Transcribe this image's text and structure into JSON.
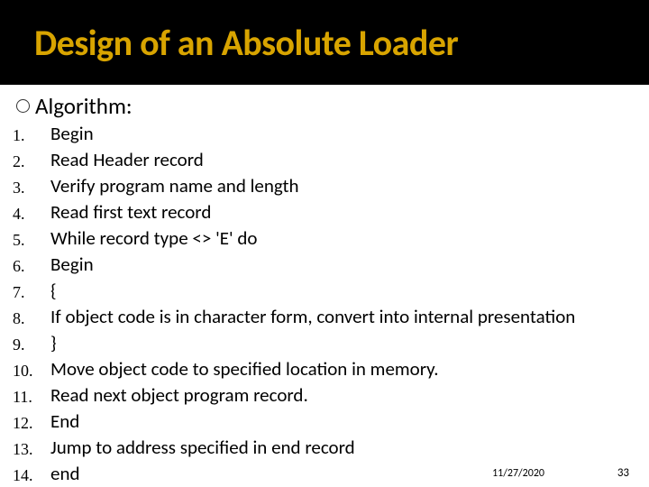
{
  "title": "Design of an Absolute Loader",
  "section_label": "Algorithm:",
  "steps": [
    "Begin",
    "Read Header record",
    "Verify program name and length",
    "Read first text record",
    "While record type <> 'E' do",
    "Begin",
    "{",
    "If object code is in character form, convert into internal presentation",
    "}",
    "Move object code to specified location in memory.",
    "Read next object program record.",
    "End",
    "Jump to address specified in end record",
    "end"
  ],
  "footer": {
    "date": "11/27/2020",
    "slide_number": "33"
  }
}
